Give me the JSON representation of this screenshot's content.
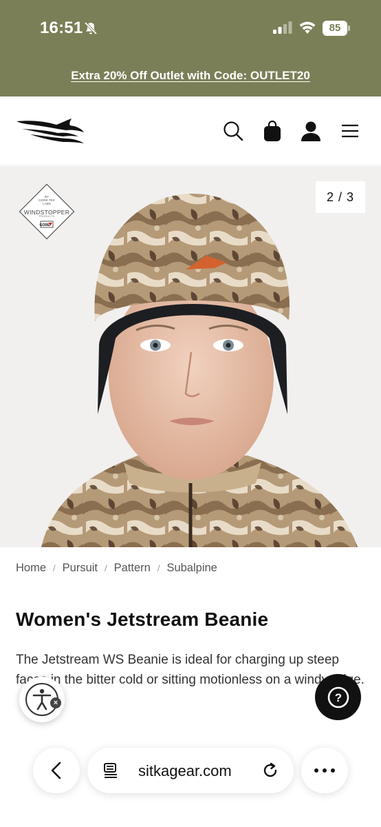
{
  "status_bar": {
    "time": "16:51",
    "battery": "85",
    "icons": [
      "bell-slash-icon",
      "cellular-signal-icon",
      "wifi-icon",
      "battery-icon"
    ]
  },
  "promo": {
    "text": "Extra 20% Off Outlet with Code: OUTLET20"
  },
  "header": {
    "logo": "sitka-logo",
    "icons": [
      "search-icon",
      "shopping-bag-icon",
      "account-icon",
      "menu-icon"
    ]
  },
  "gallery": {
    "counter": "2 / 3",
    "badge": {
      "top_text": "BY GORE-TEX LABS",
      "label": "WINDSTOPPER",
      "sub_text": "PRODUCTS",
      "brand": "GORE"
    },
    "image": "Woman wearing a camouflage beanie with black fleece band"
  },
  "breadcrumb": {
    "items": [
      "Home",
      "Pursuit",
      "Pattern",
      "Subalpine"
    ],
    "separator": "/"
  },
  "product": {
    "title": "Women's Jetstream Beanie",
    "description": "The Jetstream WS Beanie is ideal for charging up steep faces in the bitter cold or sitting motionless on a windy ridge."
  },
  "floating": {
    "accessibility_close": "×",
    "help": "?"
  },
  "browser": {
    "url": "sitkagear.com"
  },
  "colors": {
    "promo_bg": "#7b7f57",
    "help_bg": "#111111",
    "hero_bg": "#f1f0ef"
  }
}
